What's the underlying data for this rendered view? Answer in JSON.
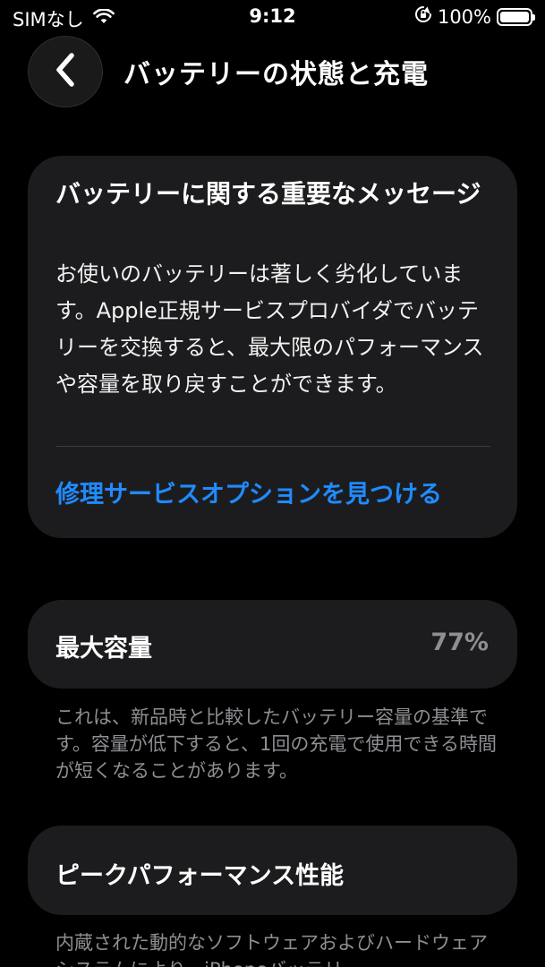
{
  "status_bar": {
    "carrier": "SIMなし",
    "time": "9:12",
    "battery_percent": "100%",
    "battery_level": 1.0
  },
  "nav": {
    "back_icon": "chevron-left-icon",
    "title": "バッテリーの状態と充電"
  },
  "message_card": {
    "title": "バッテリーに関する重要なメッセージ",
    "body": "お使いのバッテリーは著しく劣化しています。Apple正規サービスプロバイダでバッテリーを交換すると、最大限のパフォーマンスや容量を取り戻すことができます。",
    "link": "修理サービスオプションを見つける",
    "link_color": "#1f8bff"
  },
  "capacity": {
    "label": "最大容量",
    "value": "77%",
    "footnote": "これは、新品時と比較したバッテリー容量の基準です。容量が低下すると、1回の充電で使用できる時間が短くなることがあります。"
  },
  "peak": {
    "label": "ピークパフォーマンス性能",
    "footnote": "内蔵された動的なソフトウェアおよびハードウェアシステムにより、iPhoneバッテリー"
  }
}
